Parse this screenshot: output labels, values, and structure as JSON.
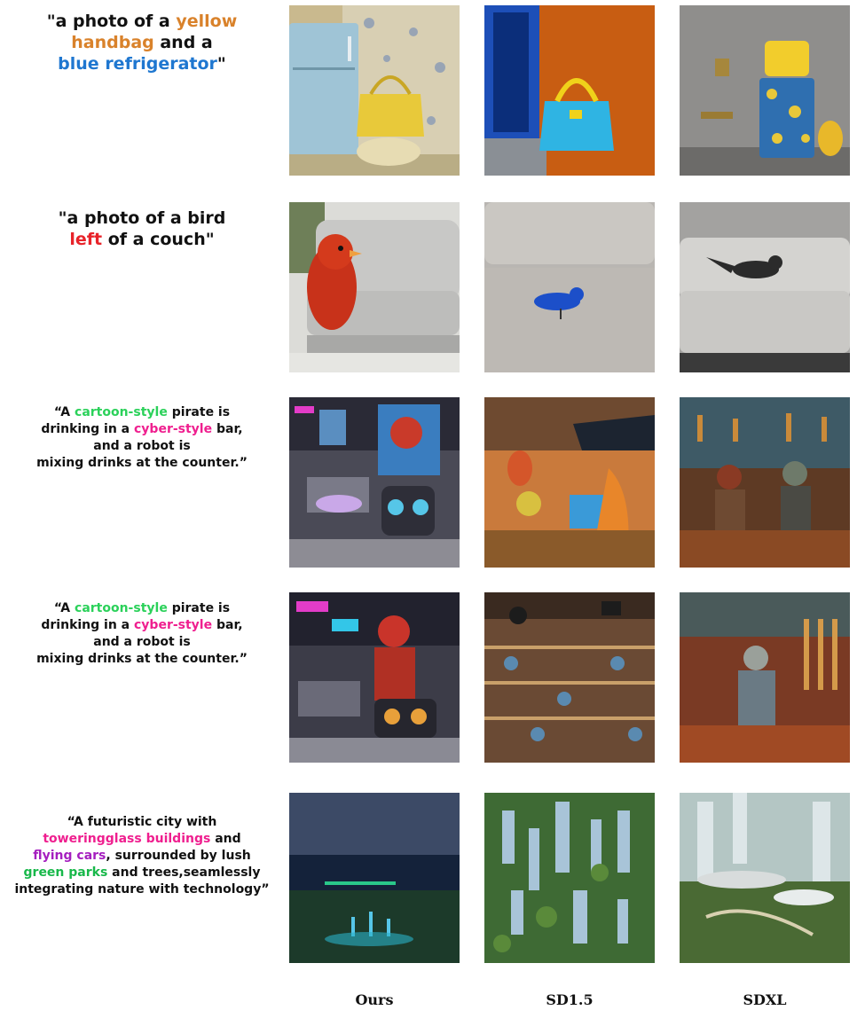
{
  "colors": {
    "orange": "#d9822b",
    "blue": "#1f77d0",
    "red": "#e8232a",
    "green": "#2bd15a",
    "pink": "#ef1f8f",
    "purple": "#a51fbf",
    "dark_green": "#18b84a"
  },
  "prompts": [
    {
      "lines": [
        [
          "\"a photo of a ",
          {
            "text": "yellow",
            "color": "orange"
          }
        ],
        [
          {
            "text": "handbag",
            "color": "orange"
          },
          " and a"
        ],
        [
          {
            "text": "blue refrigerator",
            "color": "blue"
          },
          "\""
        ]
      ],
      "flat": [
        "\"a photo of a ",
        "yellow",
        "handbag",
        " and a",
        "blue refrigerator",
        "\""
      ]
    },
    {
      "flat": [
        "\"a photo of a bird",
        "left",
        " of a couch\""
      ]
    },
    {
      "flat": [
        "“A ",
        "cartoon-style",
        " pirate is",
        "drinking in a ",
        "cyber-style",
        " bar,",
        "and a  robot is",
        "mixing drinks at the counter.”"
      ]
    },
    {
      "flat": [
        "“A ",
        "cartoon-style",
        " pirate is",
        "drinking in a ",
        "cyber-style",
        " bar,",
        "and a  robot is",
        "mixing drinks at the counter.”"
      ]
    },
    {
      "flat": [
        "“A futuristic city with",
        "toweringglass buildings",
        " and",
        "flying cars",
        ", surrounded by lush",
        "green parks",
        " and trees,seamlessly",
        "integrating nature with technology”"
      ]
    }
  ],
  "columns": [
    "Ours",
    "SD1.5",
    "SDXL"
  ]
}
